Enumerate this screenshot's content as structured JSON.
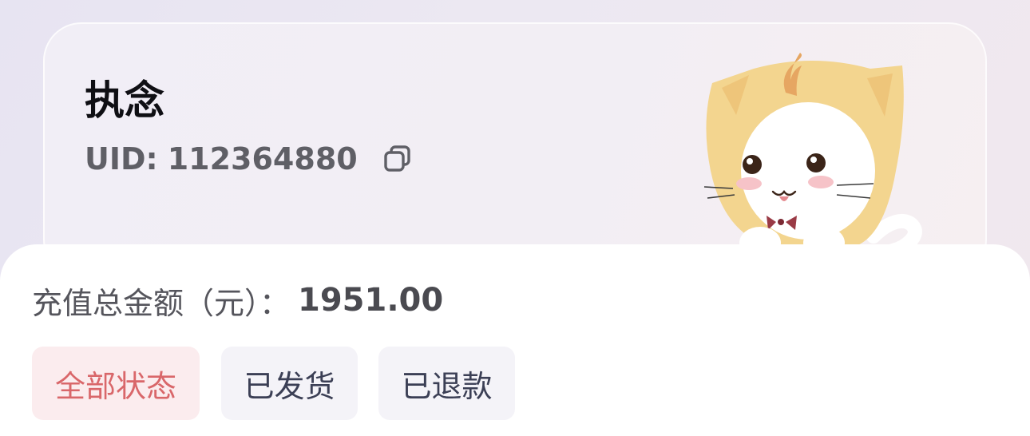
{
  "profile": {
    "name": "执念",
    "uid_label": "UID:",
    "uid_value": "112364880",
    "copy_icon": "copy-icon",
    "mascot": "cat-mascot-illustration"
  },
  "summary": {
    "total_label": "充值总金额（元）：",
    "total_value": "1951.00"
  },
  "filters": {
    "items": [
      {
        "label": "全部状态",
        "active": true
      },
      {
        "label": "已发货",
        "active": false
      },
      {
        "label": "已退款",
        "active": false
      }
    ]
  },
  "colors": {
    "active_tab_text": "#d9676a",
    "active_tab_bg": "#fbecee",
    "inactive_tab_text": "#3b3f55",
    "inactive_tab_bg": "#f4f3f8",
    "mascot_fur": "#f3d58f"
  }
}
